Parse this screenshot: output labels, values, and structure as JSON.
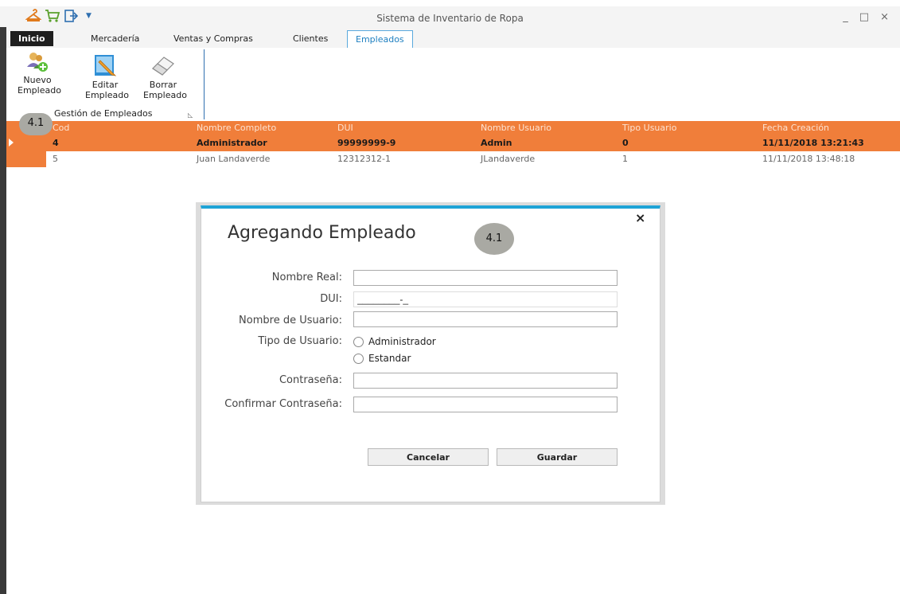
{
  "window": {
    "title": "Sistema de Inventario de Ropa",
    "controls": [
      "_",
      "□",
      "×"
    ],
    "quick_access_icons": [
      "hanger-icon",
      "cart-icon",
      "exit-icon",
      "dropdown-icon"
    ]
  },
  "tabs": [
    {
      "label": "Inicio",
      "active": false
    },
    {
      "label": "Mercadería",
      "active": false
    },
    {
      "label": "Ventas y Compras",
      "active": false
    },
    {
      "label": "Clientes",
      "active": false
    },
    {
      "label": "Empleados",
      "active": true
    }
  ],
  "ribbon": {
    "buttons": [
      {
        "label": "Nuevo\nEmpleado",
        "icon": "add-user-icon"
      },
      {
        "label": "Editar\nEmpleado",
        "icon": "edit-icon"
      },
      {
        "label": "Borrar\nEmpleado",
        "icon": "eraser-icon"
      }
    ],
    "group_label": "Gestión de Empleados"
  },
  "badges": [
    "4.1",
    "4.1"
  ],
  "grid": {
    "columns": [
      "Cod",
      "Nombre Completo",
      "DUI",
      "Nombre Usuario",
      "Tipo Usuario",
      "Fecha Creación"
    ],
    "rows": [
      [
        "4",
        "Administrador",
        "99999999-9",
        "Admin",
        "0",
        "11/11/2018 13:21:43"
      ],
      [
        "5",
        "Juan Landaverde",
        "12312312-1",
        "JLandaverde",
        "1",
        "11/11/2018 13:48:18"
      ]
    ]
  },
  "dialog": {
    "title": "Agregando Empleado",
    "close": "×",
    "labels": {
      "nombre_real": "Nombre Real:",
      "dui": "DUI:",
      "nombre_usuario": "Nombre de Usuario:",
      "tipo_usuario": "Tipo de Usuario:",
      "contrasena": "Contraseña:",
      "confirmar": "Confirmar Contraseña:"
    },
    "values": {
      "nombre_real": "",
      "dui": "________-_",
      "nombre_usuario": "",
      "contrasena": "",
      "confirmar": ""
    },
    "radio_options": [
      "Administrador",
      "Estandar"
    ],
    "buttons": {
      "cancel": "Cancelar",
      "save": "Guardar"
    }
  },
  "colors": {
    "accent_orange": "#f07e3a",
    "dialog_accent": "#1ea3d6",
    "tab_active_text": "#1e7fc0"
  }
}
